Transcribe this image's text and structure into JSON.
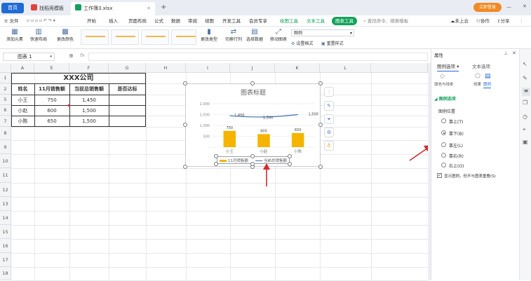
{
  "titlebar": {
    "home_tab": "首页",
    "tab1": "找稻壳模板",
    "tab2": "工作簿3.xlsx",
    "new_tab": "+",
    "login_btn": "立即登录"
  },
  "menu": {
    "file": "≡ 文件",
    "items": [
      "开始",
      "插入",
      "页面布局",
      "公式",
      "数据",
      "审阅",
      "视图",
      "开发工具",
      "会员专享"
    ],
    "ctx": [
      "绘图工具",
      "文本工具"
    ],
    "ctx_active": "图表工具",
    "search": "查找命令、搜索模板",
    "cloud": "未上云",
    "collab": "协作",
    "share": "分享"
  },
  "ribbon": {
    "add_element": "添加元素",
    "quick_layout": "快速布局",
    "change_color": "更改颜色",
    "change_type": "更改类型",
    "switch_rowcol": "切换行列",
    "select_data": "选择数据",
    "move_chart": "移动图表",
    "dropdown_value": "图例",
    "set_format": "设置格式",
    "reset_style": "重置样式"
  },
  "formula": {
    "name_box": "图表 1",
    "fx": "fx"
  },
  "sheet": {
    "cols": [
      "A",
      "D",
      "E",
      "F",
      "G",
      "H",
      "I",
      "J",
      "K",
      "L"
    ],
    "rows": [
      "1",
      "2",
      "5",
      "6",
      "7",
      "8",
      "9",
      "10",
      "11",
      "12",
      "13",
      "14",
      "15",
      "16",
      "17",
      "18"
    ],
    "title": "XXX公司",
    "headers": [
      "姓名",
      "11月销售额",
      "当前总销售额",
      "是否达标"
    ],
    "data": [
      [
        "小王",
        "750",
        "1,450",
        ""
      ],
      [
        "小赵",
        "600",
        "1,500",
        ""
      ],
      [
        "小陈",
        "650",
        "1,500",
        ""
      ]
    ]
  },
  "chart_data": {
    "type": "bar",
    "title": "图表标题",
    "categories": [
      "小王",
      "小赵",
      "小陈"
    ],
    "series": [
      {
        "name": "11月销售额",
        "type": "bar",
        "values": [
          750,
          600,
          650
        ],
        "color": "#f5b400"
      },
      {
        "name": "当前总销售额",
        "type": "line",
        "values": [
          1450,
          1500,
          1500
        ],
        "color": "#3d6fb6"
      }
    ],
    "data_labels": {
      "bar": [
        "750",
        "600",
        "650"
      ],
      "line": [
        "1,450",
        "1,500",
        "1,500"
      ]
    },
    "yticks": [
      "2,000",
      "1,500",
      "1,000",
      "500",
      "-"
    ],
    "ylim": [
      0,
      2000
    ],
    "grid": true,
    "legend_position": "bottom"
  },
  "panel": {
    "title": "属性",
    "tab_active": "图例选项",
    "tab_other": "文本选项",
    "subtabs": [
      "填充与线条",
      "效果",
      "图例"
    ],
    "section": "图例选项",
    "position_label": "图例位置",
    "options": [
      "靠上(T)",
      "靠下(B)",
      "靠左(L)",
      "靠右(R)",
      "右上(O)"
    ],
    "selected_index": 1,
    "checkbox_label": "显示图例，但不与图表重叠(S)"
  },
  "colors": {
    "accent": "#1f6bd6",
    "ctx_green": "#12a35a",
    "arrow_red": "#d62a2a"
  }
}
